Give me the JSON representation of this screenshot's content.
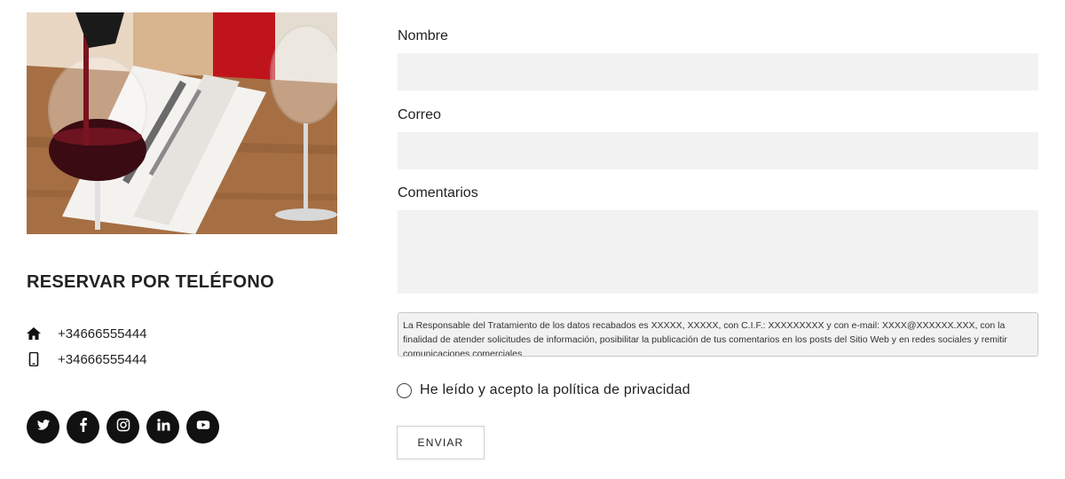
{
  "contact": {
    "heading": "RESERVAR POR TELÉFONO",
    "phone_home": "+34666555444",
    "phone_mobile": "+34666555444"
  },
  "socials": [
    {
      "icon": "twitter-icon"
    },
    {
      "icon": "facebook-icon"
    },
    {
      "icon": "instagram-icon"
    },
    {
      "icon": "linkedin-icon"
    },
    {
      "icon": "youtube-icon"
    }
  ],
  "form": {
    "name_label": "Nombre",
    "name_value": "",
    "email_label": "Correo",
    "email_value": "",
    "comments_label": "Comentarios",
    "comments_value": "",
    "legal_text": "La Responsable del Tratamiento de los datos recabados es XXXXX, XXXXX, con C.I.F.: XXXXXXXXX y con e-mail: XXXX@XXXXXX.XXX, con la finalidad de atender solicitudes de información, posibilitar la publicación de tus comentarios en los posts del Sitio Web y en redes sociales y remitir comunicaciones comerciales",
    "privacy_label": "He leído y acepto la política de privacidad",
    "privacy_checked": false,
    "submit_label": "ENVIAR"
  },
  "colors": {
    "field_bg": "#f2f2f2",
    "social_bg": "#111111",
    "text": "#222222"
  }
}
